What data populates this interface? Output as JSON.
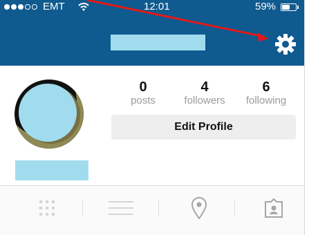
{
  "status_bar": {
    "carrier": "EMT",
    "time": "12:01",
    "battery": "59%",
    "battery_level": 0.59,
    "signal_strength": 3,
    "signal_total": 5,
    "signal_icon": "signal-dots-icon",
    "wifi_icon": "wifi-icon",
    "battery_icon": "battery-icon"
  },
  "header": {
    "settings_icon": "gear-icon",
    "username_redacted": true
  },
  "profile": {
    "avatar_redacted": true,
    "name_redacted": true,
    "stats": [
      {
        "value": "0",
        "label": "posts"
      },
      {
        "value": "4",
        "label": "followers"
      },
      {
        "value": "6",
        "label": "following"
      }
    ],
    "edit_button": "Edit Profile"
  },
  "tabs": [
    {
      "icon": "grid-icon"
    },
    {
      "icon": "list-icon"
    },
    {
      "icon": "location-pin-icon"
    },
    {
      "icon": "tagged-photos-icon"
    }
  ],
  "colors": {
    "header_blue": "#0f5a8f",
    "redaction_blue": "#a1dcee",
    "annotation_red": "#e11919",
    "stat_label_gray": "#9a9a9a",
    "button_gray": "#eeeeee"
  }
}
